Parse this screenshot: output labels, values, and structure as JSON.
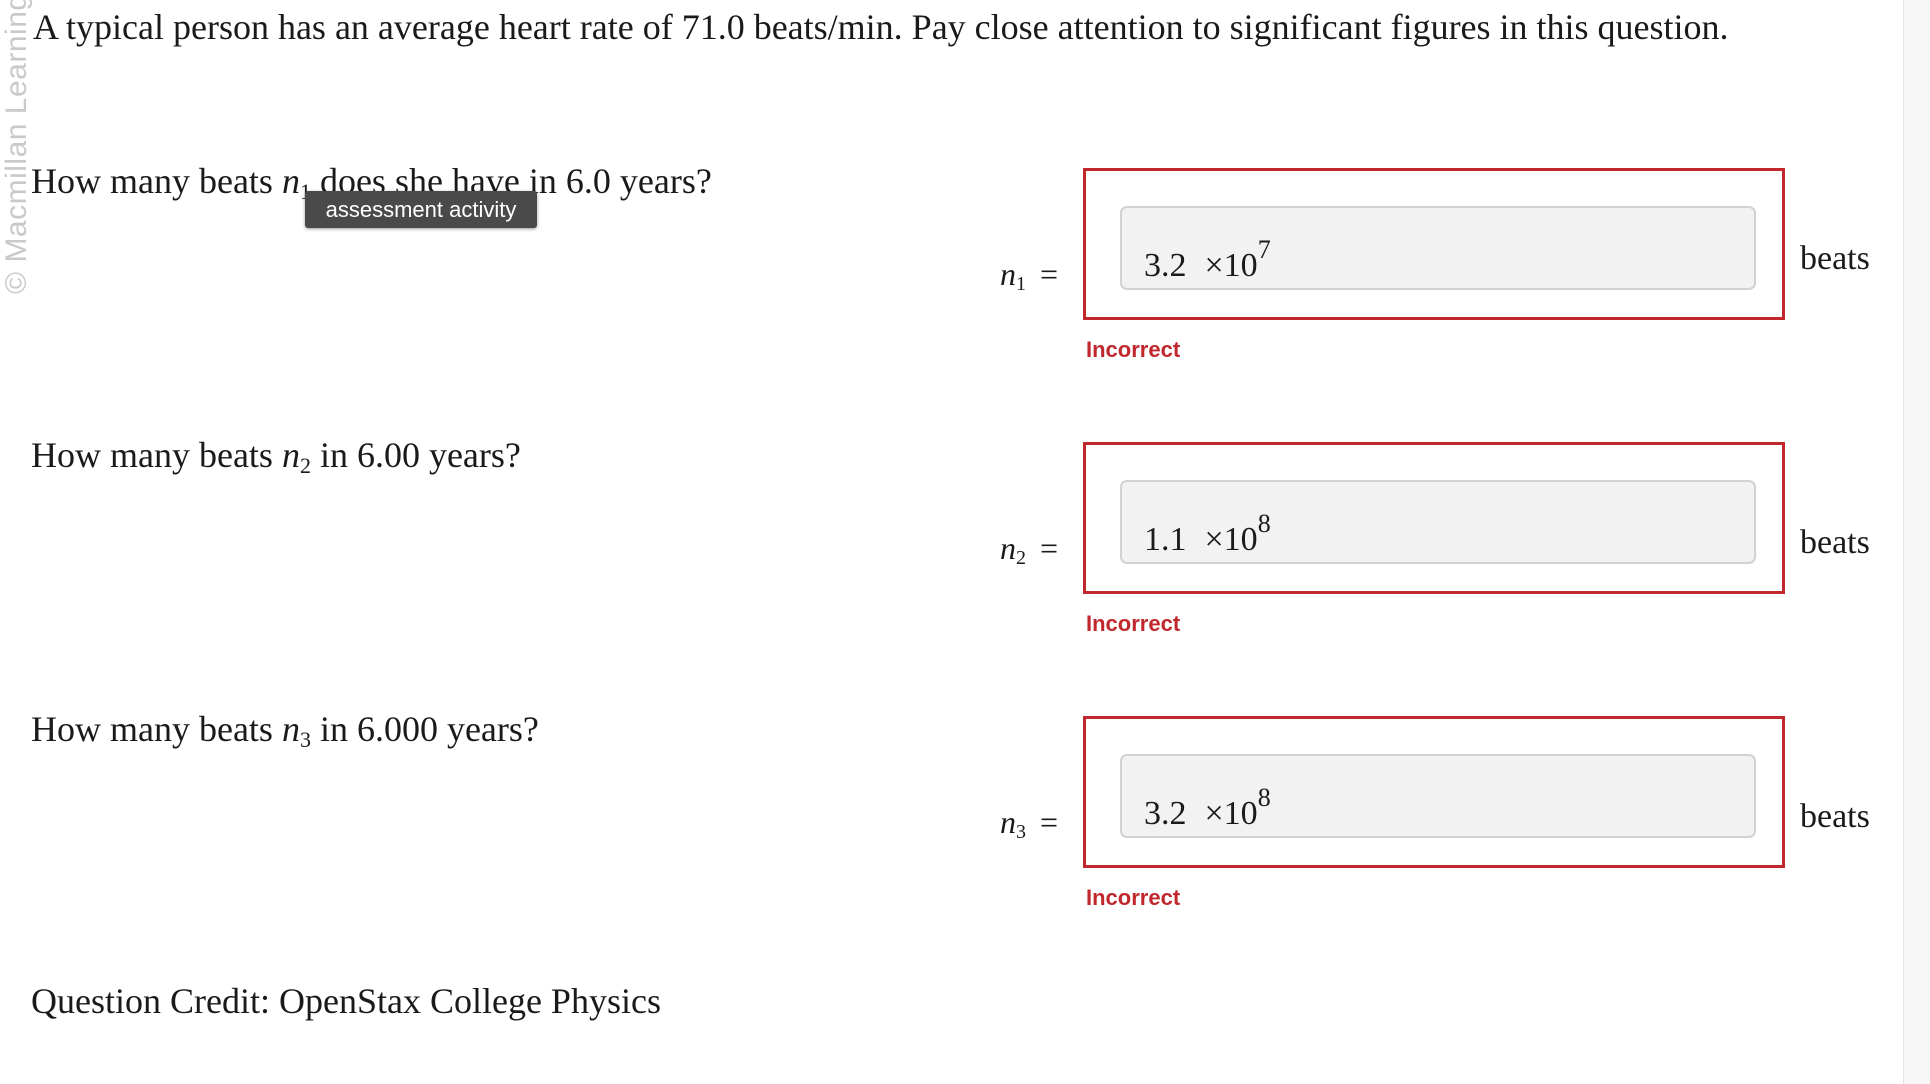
{
  "watermark": "© Macmillan Learning",
  "intro": "A typical person has an average heart rate of 71.0 beats/min. Pay close attention to significant figures in this question.",
  "tooltip": "assessment activity",
  "questions": [
    {
      "pre": "How many beats ",
      "var": "n",
      "sub": "1",
      "post": " does she have in 6.0 years?",
      "answer": {
        "mantissa": "3.2",
        "times": "×10",
        "exponent": "7"
      },
      "status": "Incorrect",
      "unit": "beats"
    },
    {
      "pre": "How many beats ",
      "var": "n",
      "sub": "2",
      "post": " in 6.00 years?",
      "answer": {
        "mantissa": "1.1",
        "times": "×10",
        "exponent": "8"
      },
      "status": "Incorrect",
      "unit": "beats"
    },
    {
      "pre": "How many beats ",
      "var": "n",
      "sub": "3",
      "post": " in 6.000 years?",
      "answer": {
        "mantissa": "3.2",
        "times": "×10",
        "exponent": "8"
      },
      "status": "Incorrect",
      "unit": "beats"
    }
  ],
  "equals": "=",
  "credit": "Question Credit: OpenStax College Physics",
  "colors": {
    "error": "#c0282d",
    "input_bg": "#f2f2f2",
    "tooltip_bg": "#4a4a4a"
  }
}
